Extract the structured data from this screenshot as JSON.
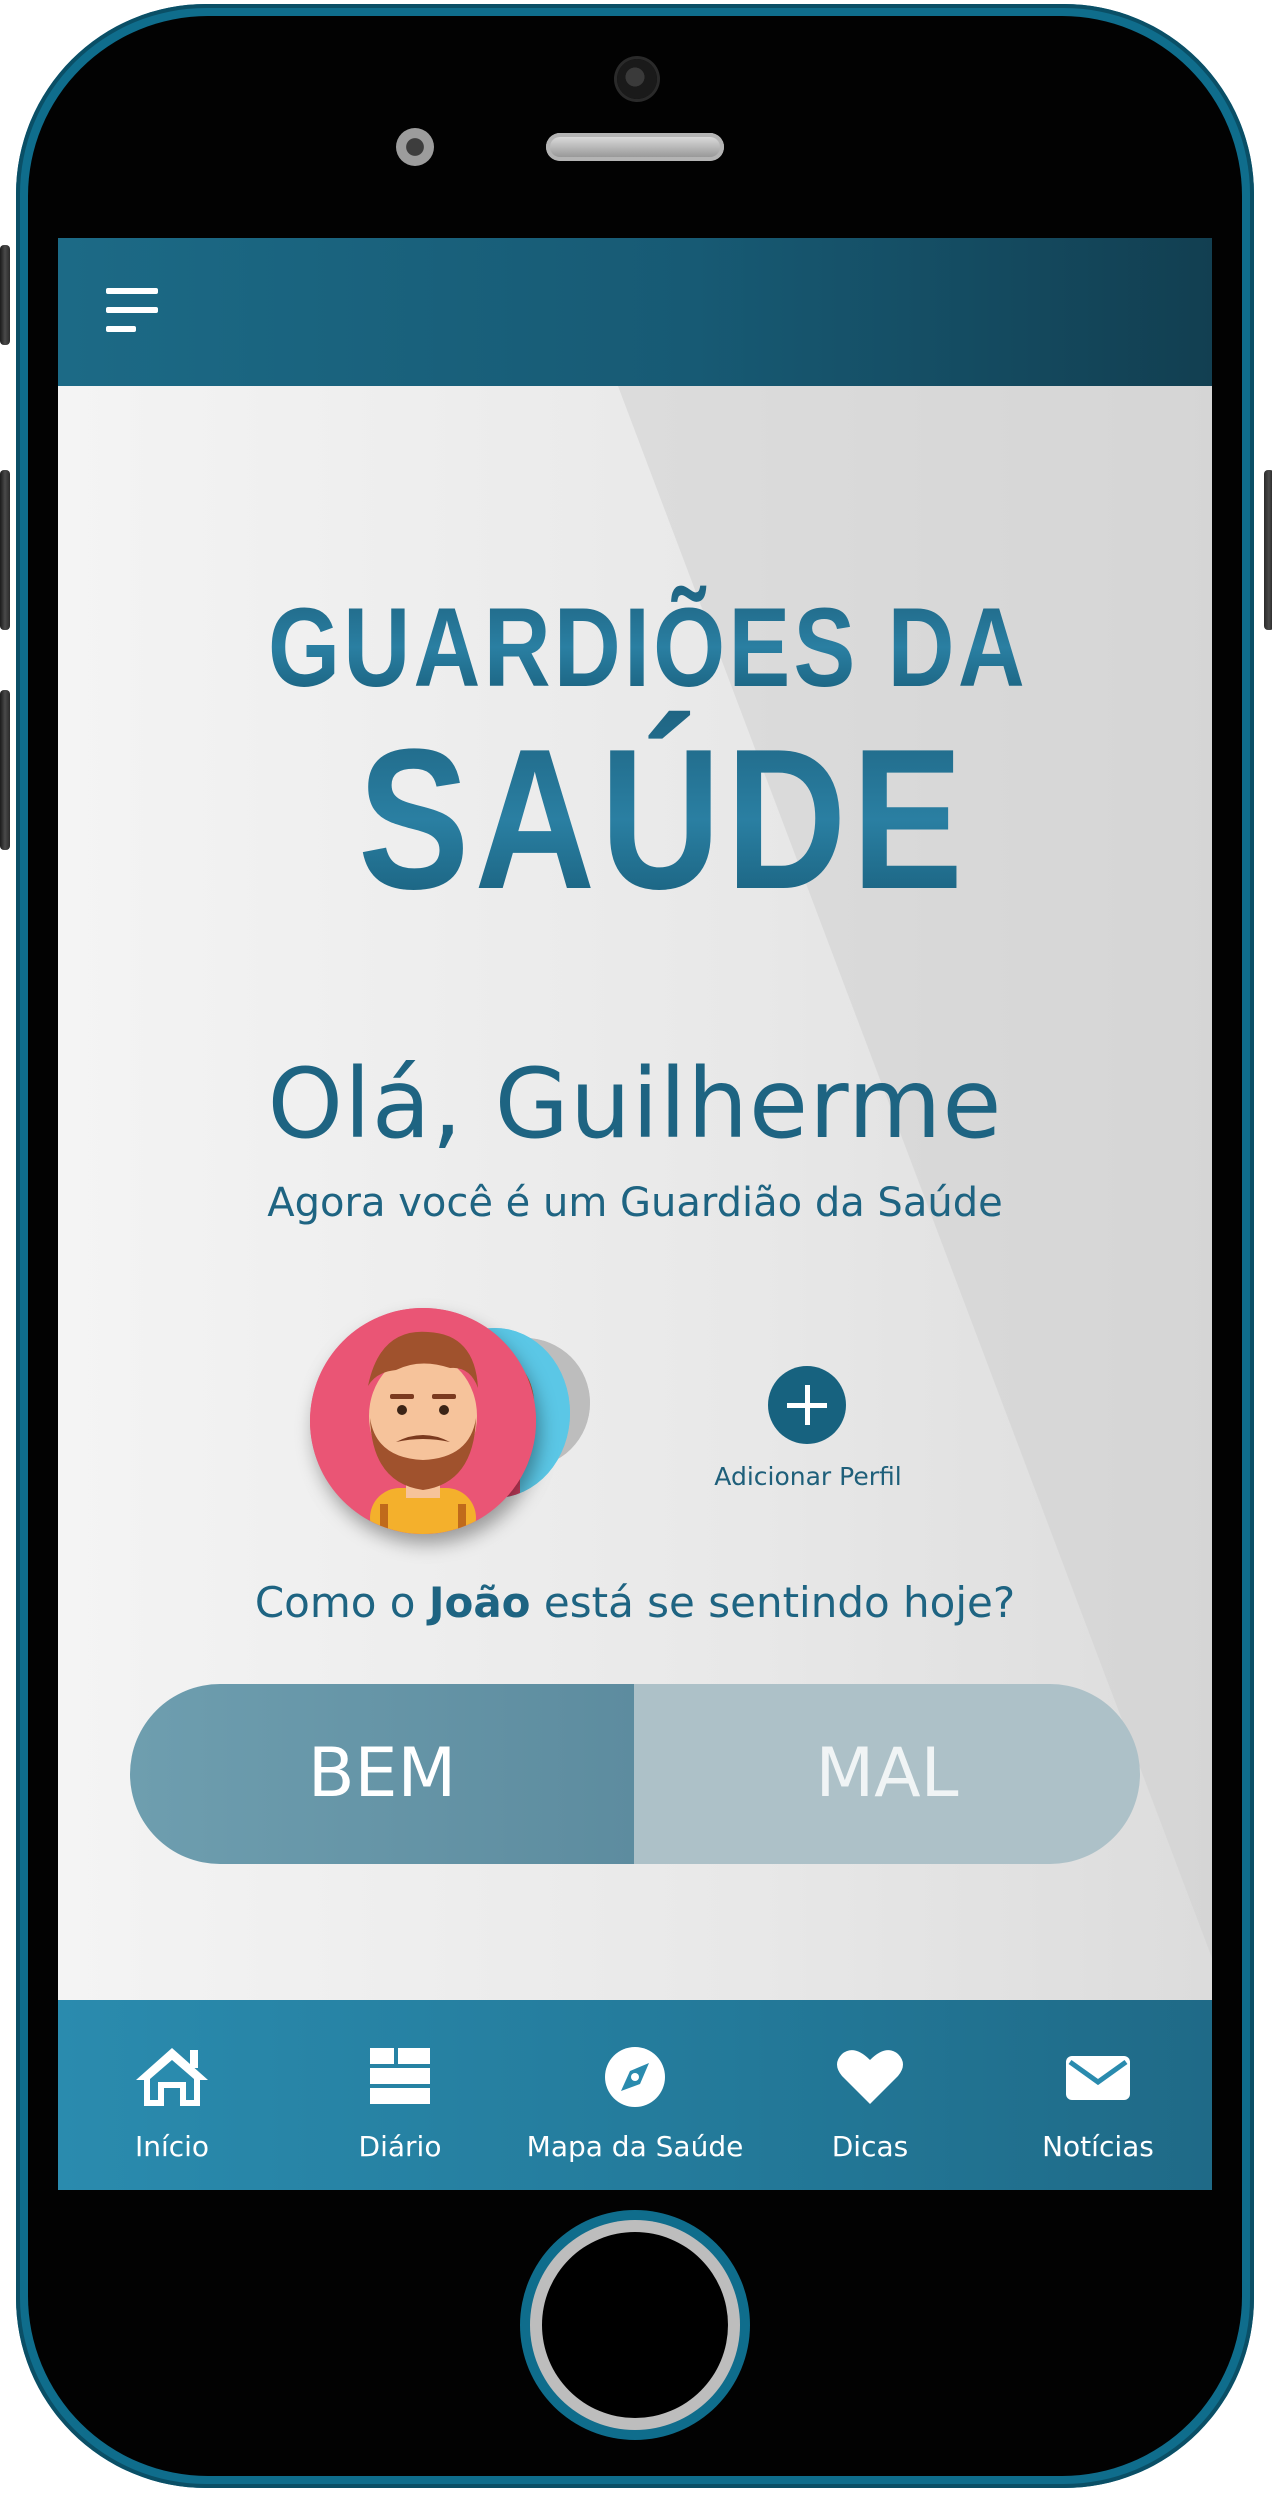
{
  "app": {
    "logo_text_line1": "GUARDIÕES DA",
    "logo_text_line2": "SAÚDE"
  },
  "header": {
    "menu_icon": "hamburger-menu-icon"
  },
  "greeting": {
    "title": "Olá, Guilherme",
    "subtitle": "Agora você é um Guardião da Saúde"
  },
  "profiles": {
    "add_label": "Adicionar Perfil",
    "add_icon": "plus-icon"
  },
  "question": {
    "prefix": "Como o ",
    "name": "João",
    "suffix": " está se sentindo hoje?"
  },
  "mood_toggle": {
    "good_label": "BEM",
    "bad_label": "MAL"
  },
  "bottom_nav": [
    {
      "label": "Início",
      "icon": "home-icon"
    },
    {
      "label": "Diário",
      "icon": "list-icon"
    },
    {
      "label": "Mapa da Saúde",
      "icon": "compass-icon"
    },
    {
      "label": "Dicas",
      "icon": "heart-icon"
    },
    {
      "label": "Notícias",
      "icon": "mail-icon"
    }
  ],
  "colors": {
    "primary": "#1e6482",
    "nav": "#2a8bae",
    "bem": "#6e9eaf",
    "mal": "#adc1c8",
    "avatar_bg": "#ea5575"
  }
}
